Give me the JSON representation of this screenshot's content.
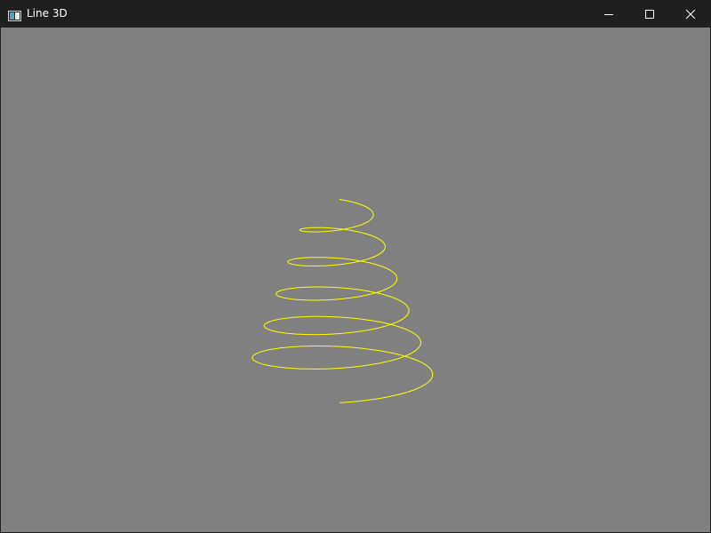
{
  "window": {
    "title": "Line 3D",
    "icons": {
      "app": "app-window-icon",
      "minimize": "minimize-icon",
      "maximize": "maximize-icon",
      "close": "close-icon"
    }
  },
  "scene": {
    "background_color": "#808080",
    "line_color": "#ffff00",
    "titlebar_color": "#1f1f1f"
  }
}
